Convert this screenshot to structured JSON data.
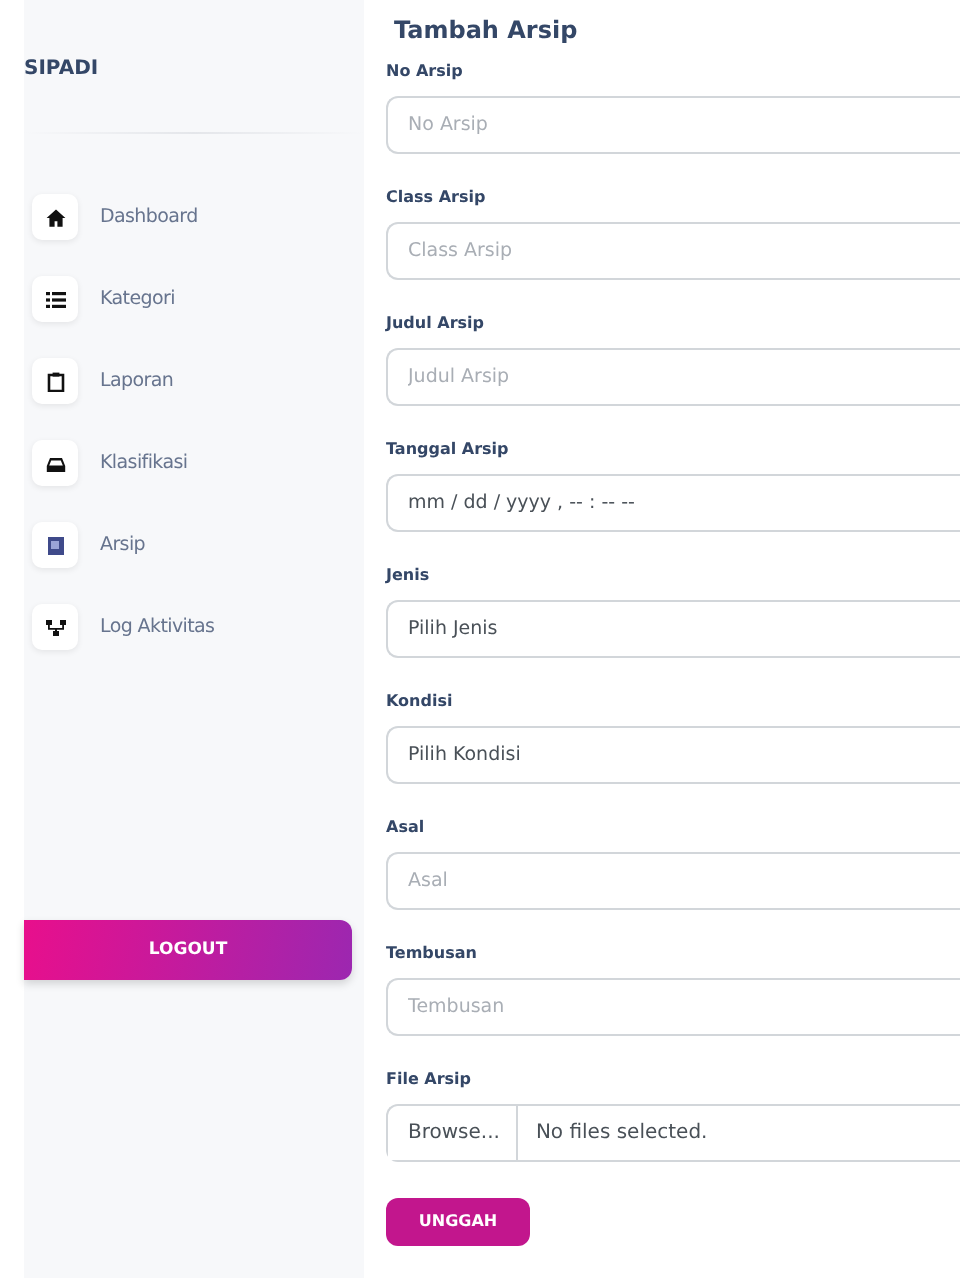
{
  "sidebar": {
    "brand": "SIPADI",
    "items": [
      {
        "label": "Dashboard"
      },
      {
        "label": "Kategori"
      },
      {
        "label": "Laporan"
      },
      {
        "label": "Klasifikasi"
      },
      {
        "label": "Arsip"
      },
      {
        "label": "Log Aktivitas"
      }
    ],
    "logout": "LOGOUT"
  },
  "form": {
    "title": "Tambah Arsip",
    "fields": [
      {
        "kind": "text",
        "label": "No Arsip",
        "placeholder": "No Arsip"
      },
      {
        "kind": "text",
        "label": "Class Arsip",
        "placeholder": "Class Arsip"
      },
      {
        "kind": "text",
        "label": "Judul Arsip",
        "placeholder": "Judul Arsip"
      },
      {
        "kind": "date",
        "label": "Tanggal Arsip",
        "value": "mm / dd / yyyy ,  -- : --   --"
      },
      {
        "kind": "select",
        "label": "Jenis",
        "value": "Pilih Jenis"
      },
      {
        "kind": "select",
        "label": "Kondisi",
        "value": "Pilih Kondisi"
      },
      {
        "kind": "text",
        "label": "Asal",
        "placeholder": "Asal"
      },
      {
        "kind": "text",
        "label": "Tembusan",
        "placeholder": "Tembusan"
      },
      {
        "kind": "file",
        "label": "File Arsip",
        "button": "Browse...",
        "status": "No files selected."
      }
    ],
    "submit": "UNGGAH"
  }
}
